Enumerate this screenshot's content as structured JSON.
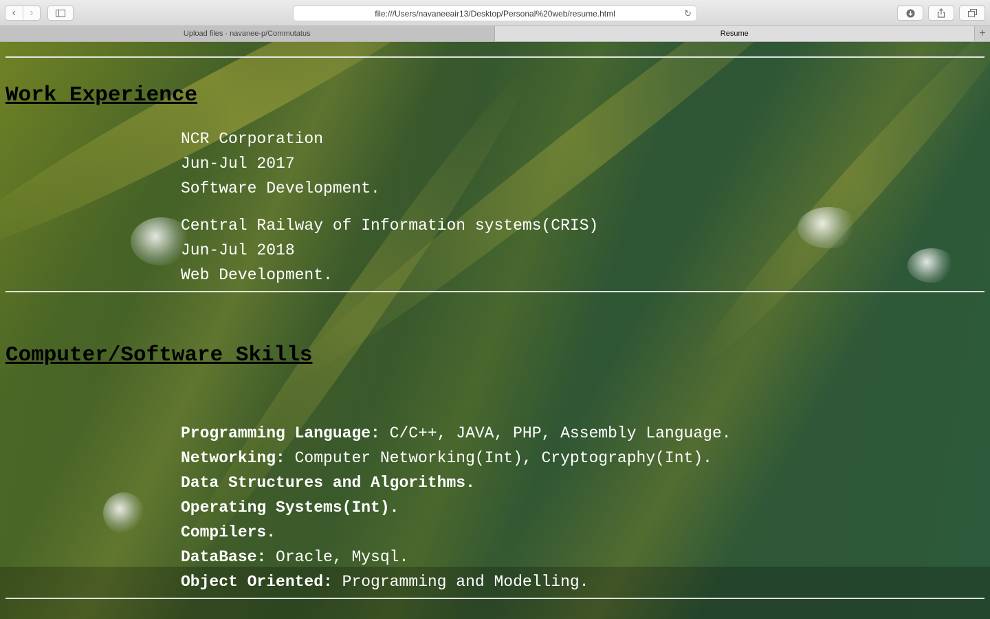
{
  "browser": {
    "url": "file:///Users/navaneeair13/Desktop/Personal%20web/resume.html",
    "tabs": [
      {
        "label": "Upload files · navanee-p/Commutatus",
        "active": false
      },
      {
        "label": "Resume",
        "active": true
      }
    ]
  },
  "work": {
    "heading": "Work Experience",
    "jobs": [
      {
        "company": "NCR Corporation",
        "period": "Jun-Jul 2017",
        "role": "Software Development."
      },
      {
        "company": "Central Railway of Information systems(CRIS)",
        "period": "Jun-Jul 2018",
        "role": "Web Development."
      }
    ]
  },
  "skills": {
    "heading": "Computer/Software Skills",
    "items": [
      {
        "label": "Programming Language:",
        "value": " C/C++, JAVA, PHP, Assembly Language."
      },
      {
        "label": "Networking:",
        "value": " Computer Networking(Int), Cryptography(Int)."
      },
      {
        "label": "Data Structures and Algorithms.",
        "value": ""
      },
      {
        "label": "Operating Systems(Int).",
        "value": ""
      },
      {
        "label": "Compilers.",
        "value": ""
      },
      {
        "label": "DataBase:",
        "value": " Oracle, Mysql."
      },
      {
        "label": "Object Oriented:",
        "value": " Programming and Modelling."
      }
    ]
  },
  "icons": [
    "back-icon",
    "forward-icon",
    "sidebar-icon",
    "reload-icon",
    "download-icon",
    "share-icon",
    "tabs-icon",
    "new-tab-icon"
  ]
}
